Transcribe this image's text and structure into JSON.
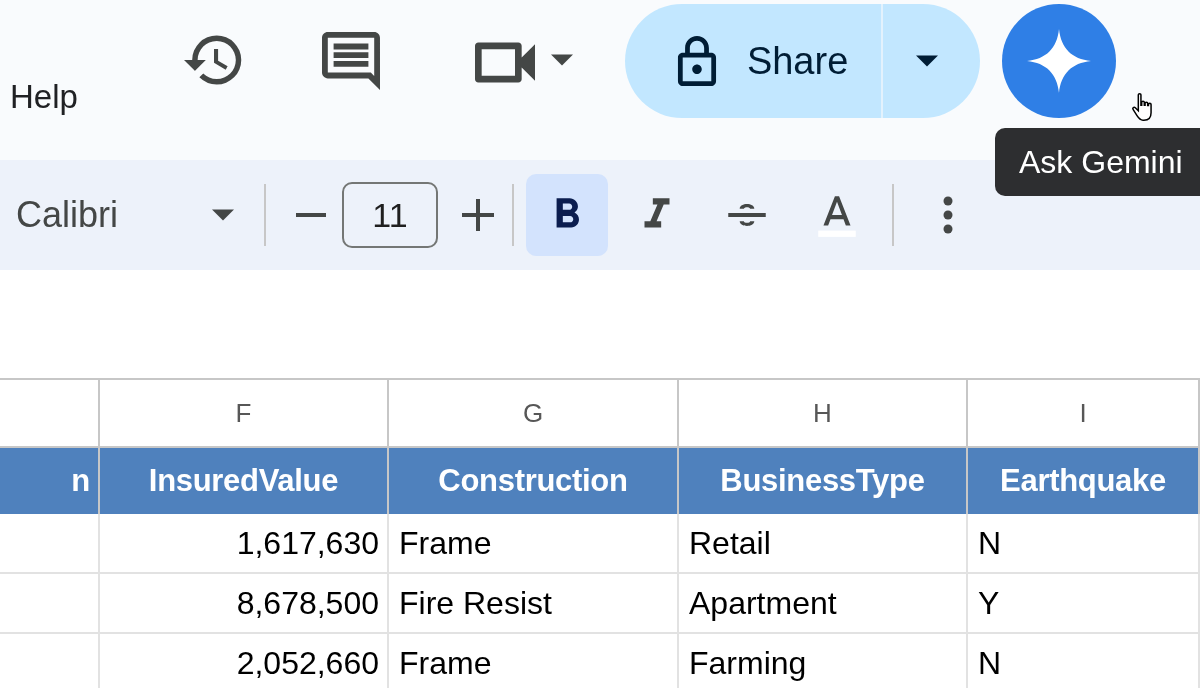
{
  "menu": {
    "items": [
      {
        "label": "Help"
      }
    ]
  },
  "share_button": {
    "label": "Share"
  },
  "tooltip": {
    "text": "Ask Gemini"
  },
  "toolbar": {
    "font": "Calibri",
    "font_size": "11",
    "format_buttons": [
      {
        "kind": "bold",
        "selected": true
      },
      {
        "kind": "italic",
        "selected": false
      },
      {
        "kind": "strikethrough",
        "selected": false
      },
      {
        "kind": "text_color",
        "selected": false
      }
    ]
  },
  "sheet": {
    "partial_column": {
      "header": "n"
    },
    "columns": [
      {
        "letter": "F",
        "header": "InsuredValue",
        "kind": "number"
      },
      {
        "letter": "G",
        "header": "Construction",
        "kind": "text"
      },
      {
        "letter": "H",
        "header": "BusinessType",
        "kind": "text"
      },
      {
        "letter": "I",
        "header": "Earthquake",
        "kind": "text"
      }
    ],
    "rows": [
      {
        "cells": [
          "1,617,630",
          "Frame",
          "Retail",
          "N"
        ]
      },
      {
        "cells": [
          "8,678,500",
          "Fire Resist",
          "Apartment",
          "Y"
        ]
      },
      {
        "cells": [
          "2,052,660",
          "Frame",
          "Farming",
          "N"
        ]
      }
    ]
  }
}
